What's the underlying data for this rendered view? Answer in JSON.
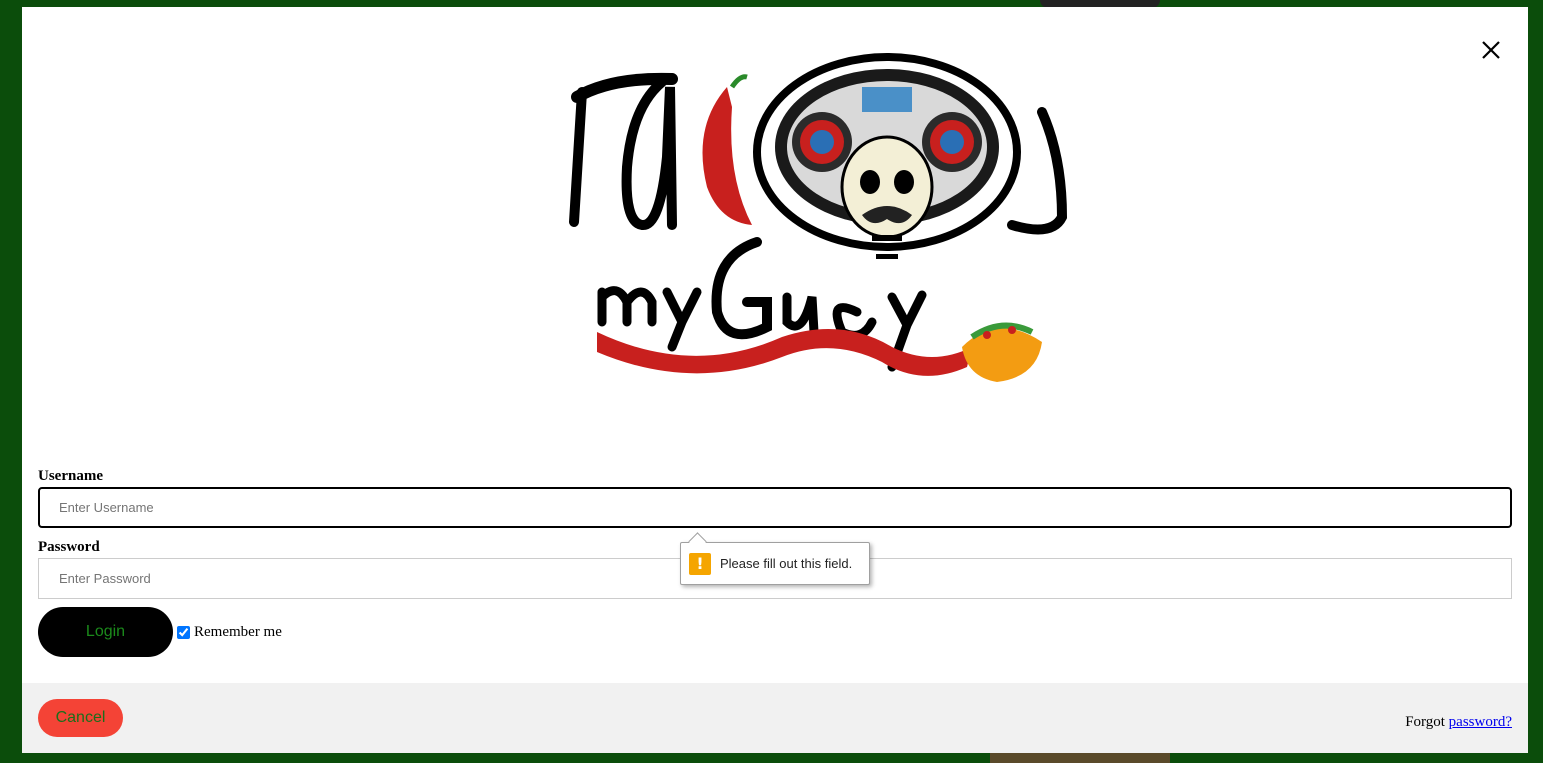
{
  "modal": {
    "close_icon": "close-icon"
  },
  "logo": {
    "alt_text": "Tacos my Guey"
  },
  "form": {
    "username_label": "Username",
    "username_placeholder": "Enter Username",
    "password_label": "Password",
    "password_placeholder": "Enter Password",
    "login_label": "Login",
    "remember_label": "Remember me",
    "remember_checked": true
  },
  "validation": {
    "message": "Please fill out this field.",
    "icon": "warning-icon"
  },
  "footer": {
    "cancel_label": "Cancel",
    "forgot_prefix": "Forgot",
    "forgot_link": "password?"
  },
  "colors": {
    "background": "#0b4d0b",
    "login_button": "#000000",
    "login_text": "#1b8a1b",
    "cancel_button": "#f44336",
    "link": "#0000ee",
    "warning": "#f5a500"
  }
}
